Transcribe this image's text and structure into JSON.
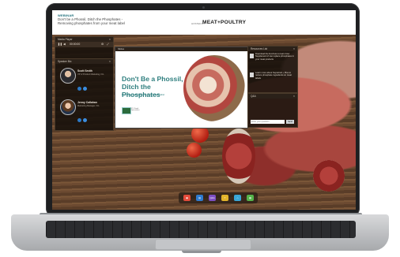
{
  "webinar": {
    "label": "WEBINAR",
    "title": "Don't be a Phossil, Ditch the Phosphates - Removing phosphates from your meat label",
    "hosted_by": "HOSTED BY",
    "brand": "MEAT+POULTRY"
  },
  "media_player": {
    "header": "Media Player",
    "status": "00:00:00"
  },
  "speakers": {
    "header": "Speaker Bio",
    "items": [
      {
        "name": "Scott Smith",
        "title": "VP of Product Marketing, ICL"
      },
      {
        "name": "Jenny Callahan",
        "title": "Marketing Manager, ICL"
      }
    ]
  },
  "slide": {
    "header": "Slides",
    "title": "Don't Be a Phossil, Ditch the Phosphates",
    "subtitle": "Removing phosphates from your meat label",
    "logo_text": "ICL Food Specialties"
  },
  "resources": {
    "header": "Resources List",
    "items": [
      {
        "text": "Download the brochure to learn how Supplement Z can replace phosphates in your meat products"
      },
      {
        "text": "Learn more about SupraCell + Plus to reduce phosphate ingredients on meat labels"
      }
    ]
  },
  "qa": {
    "header": "Q&A",
    "placeholder": "Enter your question",
    "send_label": "Send"
  },
  "dock": {
    "icons": [
      "slides-icon",
      "chat-icon",
      "qa-icon",
      "help-icon",
      "resources-icon",
      "share-icon"
    ],
    "qa_label": "Q&A"
  },
  "colors": {
    "accent": "#2f7f7f",
    "panel": "#16100a"
  }
}
